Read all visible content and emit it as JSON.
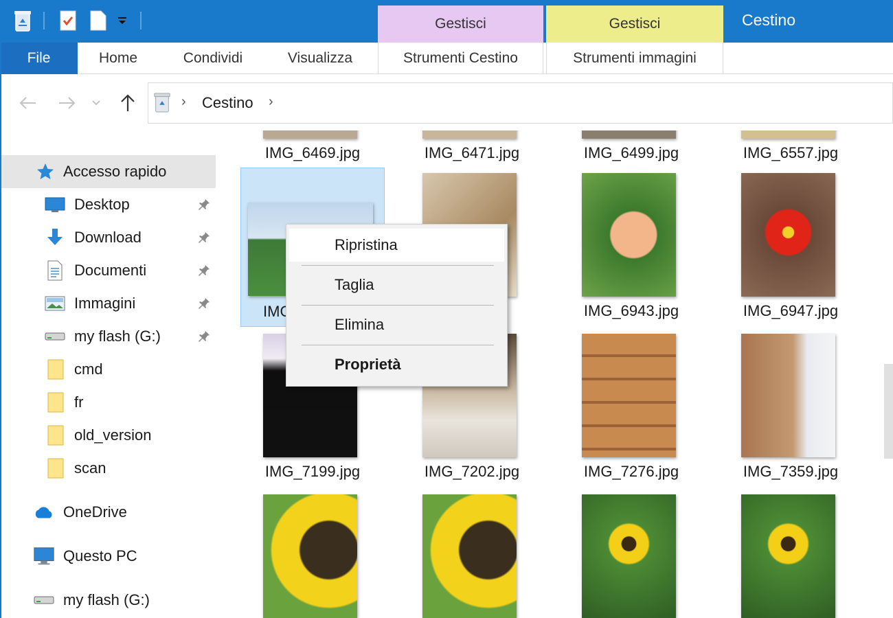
{
  "window": {
    "title": "Cestino"
  },
  "context_tabs": [
    {
      "label": "Gestisci",
      "group": "Strumenti Cestino",
      "color": "#e6c8f2"
    },
    {
      "label": "Gestisci",
      "group": "Strumenti immagini",
      "color": "#eded8c"
    }
  ],
  "ribbon": {
    "tabs": [
      "File",
      "Home",
      "Condividi",
      "Visualizza",
      "Strumenti Cestino",
      "Strumenti immagini"
    ]
  },
  "address": {
    "crumb": "Cestino"
  },
  "sidebar": {
    "quick_access": "Accesso rapido",
    "items": [
      {
        "label": "Desktop",
        "icon": "desktop-icon",
        "pinned": true
      },
      {
        "label": "Download",
        "icon": "download-icon",
        "pinned": true
      },
      {
        "label": "Documenti",
        "icon": "document-icon",
        "pinned": true
      },
      {
        "label": "Immagini",
        "icon": "pictures-icon",
        "pinned": true
      },
      {
        "label": "my flash (G:)",
        "icon": "drive-icon",
        "pinned": true
      },
      {
        "label": "cmd",
        "icon": "folder-icon",
        "pinned": false
      },
      {
        "label": "fr",
        "icon": "folder-icon",
        "pinned": false
      },
      {
        "label": "old_version",
        "icon": "folder-icon",
        "pinned": false
      },
      {
        "label": "scan",
        "icon": "folder-icon",
        "pinned": false
      }
    ],
    "onedrive": "OneDrive",
    "this_pc": "Questo PC",
    "flash": "my flash (G:)"
  },
  "files": {
    "row0": [
      "IMG_6469.jpg",
      "IMG_6471.jpg",
      "IMG_6499.jpg",
      "IMG_6557.jpg"
    ],
    "row1": [
      "IMG_6...",
      "IMG_...jpg",
      "IMG_6943.jpg",
      "IMG_6947.jpg"
    ],
    "row2": [
      "IMG_7199.jpg",
      "IMG_7202.jpg",
      "IMG_7276.jpg",
      "IMG_7359.jpg"
    ]
  },
  "context_menu": {
    "items": [
      "Ripristina",
      "Taglia",
      "Elimina",
      "Proprietà"
    ]
  },
  "colors": {
    "accent": "#1979ca",
    "selection": "#cce4f7"
  }
}
